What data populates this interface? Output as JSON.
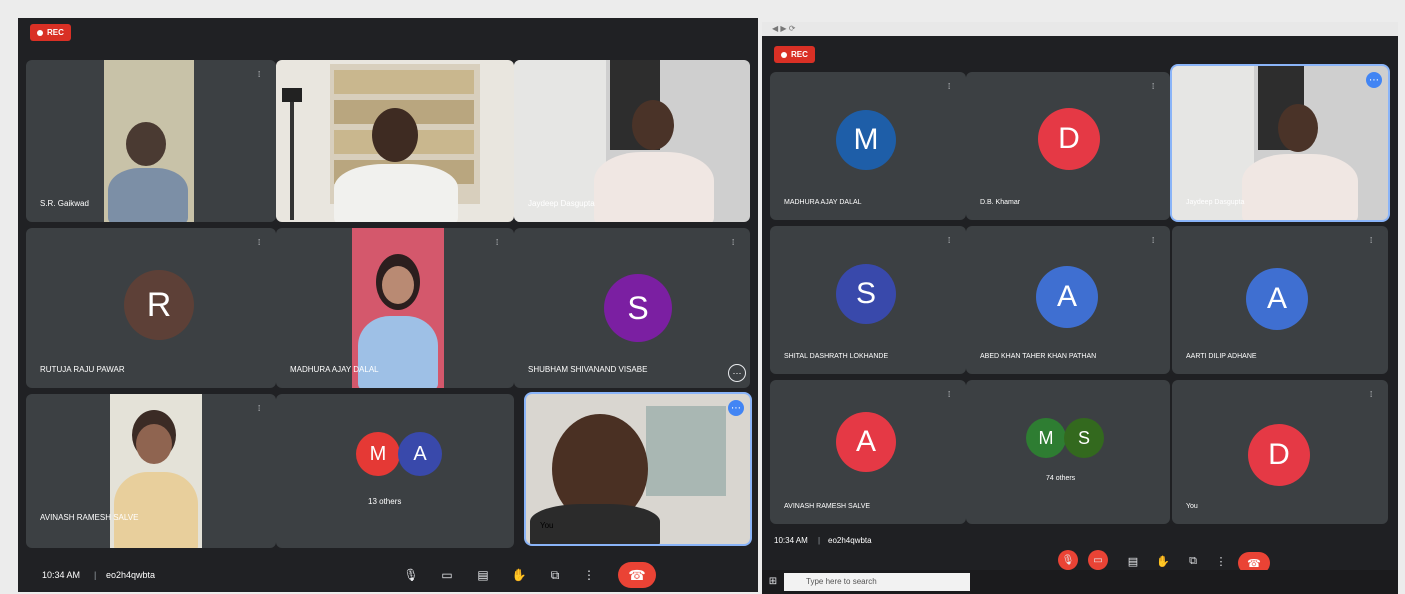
{
  "left_screen": {
    "rec_label": "REC",
    "tiles": [
      {
        "name": "S.R. Gaikwad"
      },
      {
        "name": ""
      },
      {
        "name": "Jaydeep Dasgupta"
      },
      {
        "name": "RUTUJA RAJU PAWAR",
        "initial": "R",
        "color": "#5d4037"
      },
      {
        "name": "MADHURA AJAY DALAL"
      },
      {
        "name": "SHUBHAM SHIVANAND VISABE",
        "initial": "S",
        "color": "#7b1fa2"
      },
      {
        "name": "AVINASH RAMESH SALVE"
      },
      {
        "name": "13 others",
        "initials": [
          "M",
          "A"
        ],
        "colors": [
          "#e53935",
          "#3949ab"
        ]
      },
      {
        "name": "You"
      }
    ],
    "bottom": {
      "time": "10:34 AM",
      "separator": "|",
      "code": "eo2h4qwbta"
    }
  },
  "right_screen": {
    "rec_label": "REC",
    "tiles": [
      {
        "name": "MADHURA AJAY DALAL",
        "initial": "M",
        "color": "#1e5ea8"
      },
      {
        "name": "D.B. Khamar",
        "initial": "D",
        "color": "#e53945"
      },
      {
        "name": "Jaydeep Dasgupta"
      },
      {
        "name": "SHITAL DASHRATH LOKHANDE",
        "initial": "S",
        "color": "#3949ab"
      },
      {
        "name": "ABED KHAN TAHER KHAN PATHAN",
        "initial": "A",
        "color": "#3f6fd1"
      },
      {
        "name": "AARTI DILIP ADHANE",
        "initial": "A",
        "color": "#3f6fd1"
      },
      {
        "name": "AVINASH RAMESH SALVE",
        "initial": "A",
        "color": "#e53945"
      },
      {
        "name": "74 others",
        "initials": [
          "M",
          "S"
        ],
        "colors": [
          "#2e7d32",
          "#33691e"
        ]
      },
      {
        "name": "You",
        "initial": "D",
        "color": "#e53945"
      }
    ],
    "bottom": {
      "time": "10:34 AM",
      "separator": "|",
      "code": "eo2h4qwbta"
    },
    "taskbar": {
      "search_placeholder": "Type here to search"
    }
  }
}
